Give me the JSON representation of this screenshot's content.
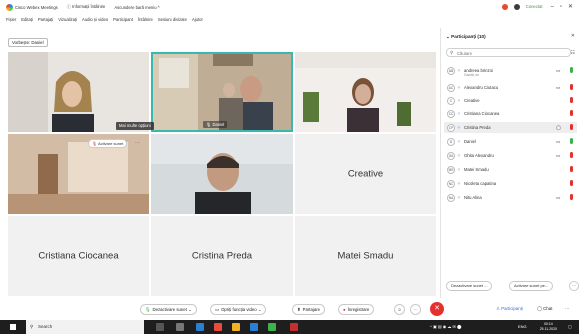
{
  "app": {
    "title": "Cisco Webex Meetings",
    "info": "Informații întâlnire",
    "hidden_menu": "Ascundere bară meniu ^",
    "status": "Conectat",
    "accent": "#37b9b0"
  },
  "menu": [
    "Fișier",
    "Editați",
    "Partajați",
    "Vizualizați",
    "Audio și video",
    "Participant",
    "Întâlnire",
    "Sesiuni divizate",
    "Ajutor"
  ],
  "view_button": "Vorbește: Daniel",
  "tiles": {
    "t2_tag": "Daniel",
    "more_options": "Mai multe opțiuni",
    "unmute": "Activare sunet",
    "creative": "Creative",
    "cristiana": "Cristiana Ciocanea",
    "cristina": "Cristina Preda",
    "matei": "Matei Smadu"
  },
  "panel": {
    "title": "Participanți (10)",
    "search_placeholder": "Căutare",
    "participants": [
      {
        "initials": "AB",
        "name": "andreea brinzoi",
        "sub": "Gazdă, eu",
        "cam": true,
        "mic": "#3cb24b"
      },
      {
        "initials": "AC",
        "name": "Alexandru Ciutacu",
        "sub": "",
        "cam": true,
        "mic": "#e5312e"
      },
      {
        "initials": "C",
        "name": "Creative",
        "sub": "",
        "cam": false,
        "mic": "#e5312e"
      },
      {
        "initials": "CC",
        "name": "Cristiana Ciocanea",
        "sub": "",
        "cam": false,
        "mic": "#e5312e"
      },
      {
        "initials": "CP",
        "name": "Cristina Preda",
        "sub": "",
        "cam": true,
        "mic": "#e5312e"
      },
      {
        "initials": "D",
        "name": "Daniel",
        "sub": "",
        "cam": true,
        "mic": "#3cb24b"
      },
      {
        "initials": "GA",
        "name": "Ghita Alexandru",
        "sub": "",
        "cam": true,
        "mic": "#e5312e"
      },
      {
        "initials": "MS",
        "name": "Matei Smadu",
        "sub": "",
        "cam": false,
        "mic": "#e5312e"
      },
      {
        "initials": "NC",
        "name": "Nicoleta capatina",
        "sub": "",
        "cam": false,
        "mic": "#e5312e"
      },
      {
        "initials": "NA",
        "name": "Nitu Alina",
        "sub": "",
        "cam": true,
        "mic": "#e5312e"
      }
    ],
    "mute_all": "Dezactivare sunet ...",
    "unmute_all": "Activare sunet pe..."
  },
  "toolbar": {
    "mute": "Dezactivare sunet",
    "video": "Opriți funcția video",
    "share": "Partajare",
    "record": "Înregistrare",
    "participants": "Participanți",
    "chat": "Chat"
  },
  "taskbar": {
    "search": "Search",
    "time": "00:14",
    "date": "25.11.2020",
    "lang": "ENG"
  }
}
